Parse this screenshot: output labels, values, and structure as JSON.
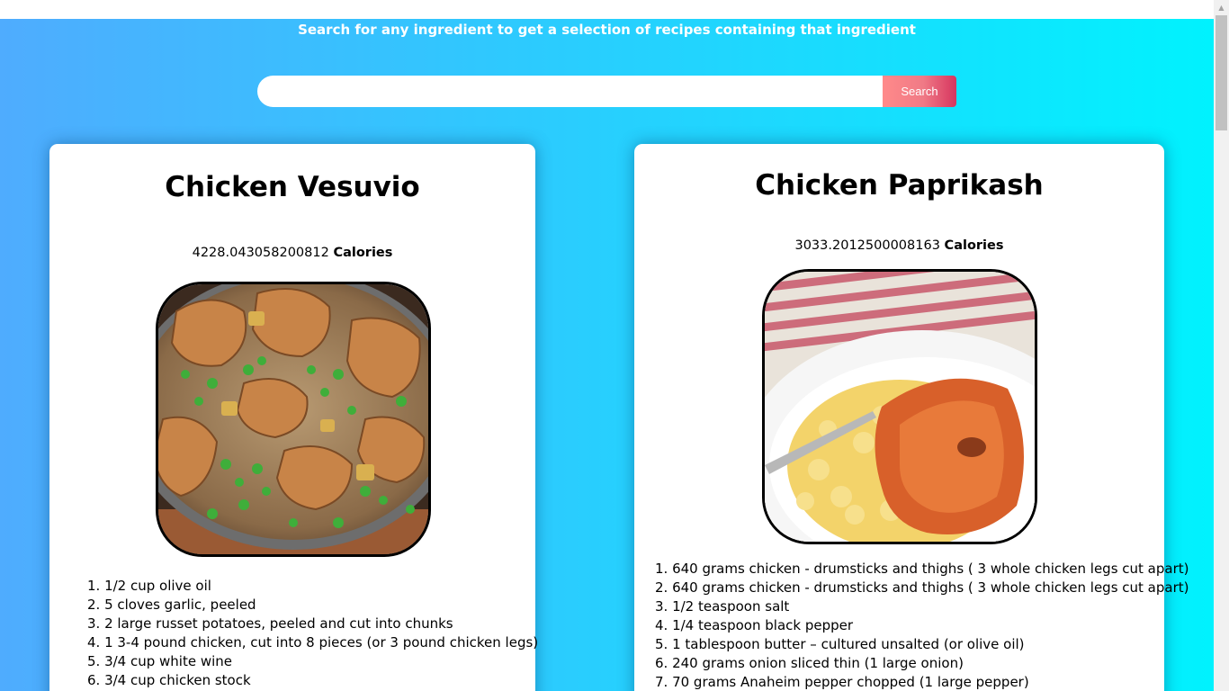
{
  "header": {
    "tagline": "Search for any ingredient to get a selection of recipes containing that ingredient"
  },
  "search": {
    "placeholder": "",
    "value": "",
    "button_label": "Search"
  },
  "recipes": [
    {
      "title": "Chicken Vesuvio",
      "calories_value": "4228.043058200812",
      "calories_label": "Calories",
      "ingredients": [
        "1. 1/2 cup olive oil",
        "2. 5 cloves garlic, peeled",
        "3. 2 large russet potatoes, peeled and cut into chunks",
        "4. 1 3-4 pound chicken, cut into 8 pieces (or 3 pound chicken legs)",
        "5. 3/4 cup white wine",
        "6. 3/4 cup chicken stock"
      ]
    },
    {
      "title": "Chicken Paprikash",
      "calories_value": "3033.2012500008163",
      "calories_label": "Calories",
      "ingredients": [
        "1. 640 grams chicken - drumsticks and thighs ( 3 whole chicken legs cut apart)",
        "2. 640 grams chicken - drumsticks and thighs ( 3 whole chicken legs cut apart)",
        "3. 1/2 teaspoon salt",
        "4. 1/4 teaspoon black pepper",
        "5. 1 tablespoon butter – cultured unsalted (or olive oil)",
        "6. 240 grams onion sliced thin (1 large onion)",
        "7. 70 grams Anaheim pepper chopped (1 large pepper)"
      ]
    }
  ],
  "scrollbar": {
    "up_arrow": "▲"
  }
}
